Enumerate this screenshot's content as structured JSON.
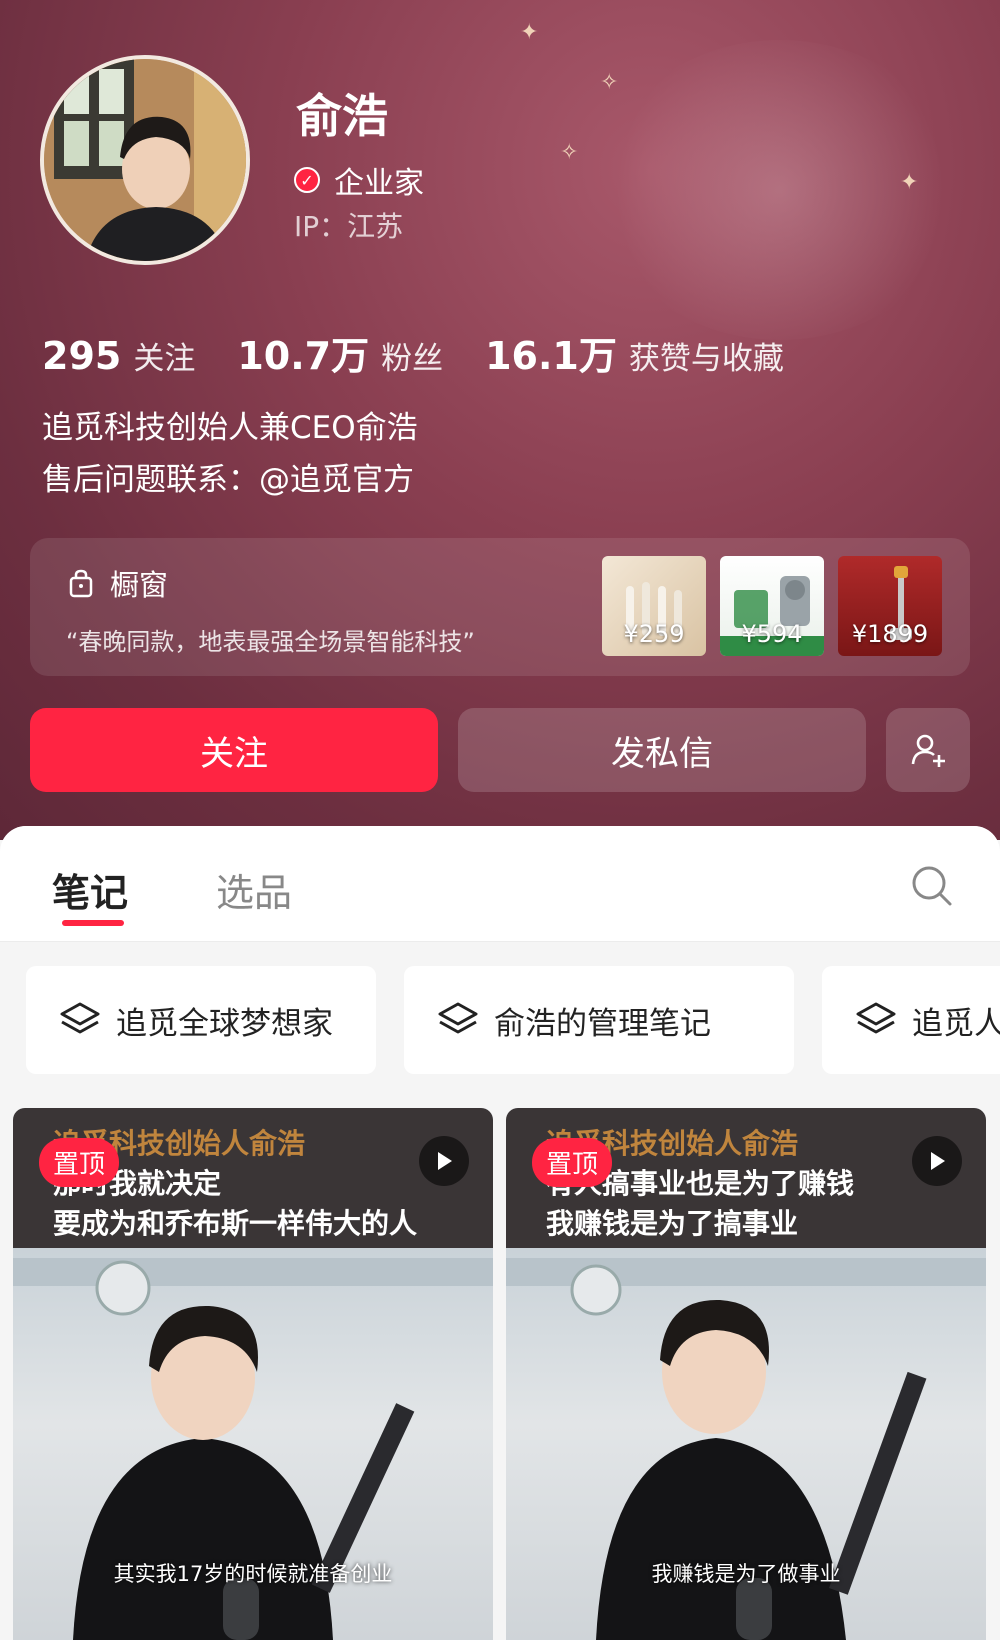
{
  "profile": {
    "name": "俞浩",
    "verify_label": "企业家",
    "ip": "IP：江苏",
    "stats": [
      {
        "num": "295",
        "label": "关注"
      },
      {
        "num": "10.7万",
        "label": "粉丝"
      },
      {
        "num": "16.1万",
        "label": "获赞与收藏"
      }
    ],
    "bio": [
      "追觅科技创始人兼CEO俞浩",
      "售后问题联系：@追觅官方"
    ]
  },
  "showcase": {
    "title": "橱窗",
    "desc": "“春晚同款，地表最强全场景智能科技”",
    "items": [
      {
        "price": "¥259"
      },
      {
        "price": "¥594"
      },
      {
        "price": "¥1899"
      }
    ]
  },
  "actions": {
    "follow": "关注",
    "message": "发私信"
  },
  "tabs": {
    "notes": "笔记",
    "select": "选品"
  },
  "collections": [
    "追觅全球梦想家",
    "俞浩的管理笔记",
    "追觅人"
  ],
  "cards": [
    {
      "pin": "置顶",
      "over": "追觅科技创始人俞浩",
      "line1": "那时我就决定",
      "line2": "要成为和乔布斯一样伟大的人",
      "subtitle": "其实我17岁的时候就准备创业"
    },
    {
      "pin": "置顶",
      "over": "追觅科技创始人俞浩",
      "line1": "有人搞事业也是为了赚钱",
      "line2": "我赚钱是为了搞事业",
      "subtitle": "我赚钱是为了做事业"
    }
  ],
  "colors": {
    "accent": "#ff2442",
    "header_bg": "#8a3f51"
  }
}
